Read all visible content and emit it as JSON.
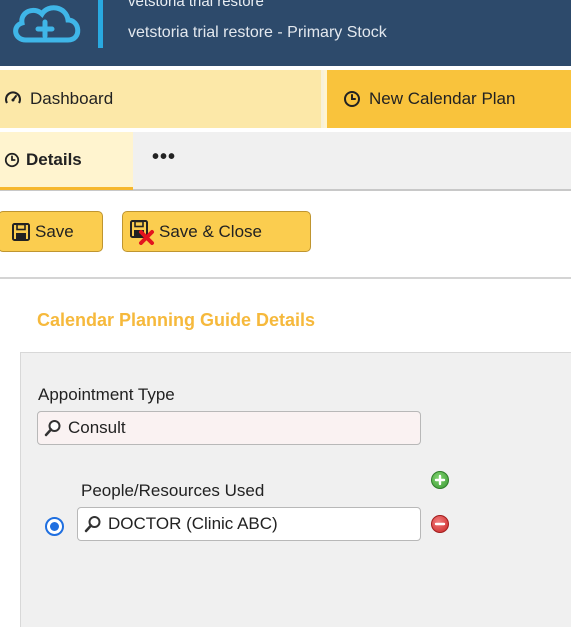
{
  "header": {
    "title": "vetstoria trial restore",
    "subtitle": "vetstoria trial restore - Primary Stock",
    "logo_icon": "cloud-plus-logo"
  },
  "tabs": [
    {
      "label": "Dashboard",
      "icon": "gauge-icon"
    },
    {
      "label": "New Calendar Plan",
      "icon": "clock-icon"
    }
  ],
  "subtabs": {
    "details_label": "Details",
    "more_label": "•••"
  },
  "toolbar": {
    "save_label": "Save",
    "save_close_label": "Save & Close"
  },
  "section": {
    "title": "Calendar Planning Guide Details"
  },
  "form": {
    "appointment_type_label": "Appointment Type",
    "appointment_type_value": "Consult",
    "people_label": "People/Resources Used",
    "people_value": "DOCTOR (Clinic ABC)"
  },
  "colors": {
    "header_bg": "#2d4a6b",
    "accent": "#f9c33c",
    "section_title": "#f6b93c",
    "radio": "#1f6fe0"
  }
}
